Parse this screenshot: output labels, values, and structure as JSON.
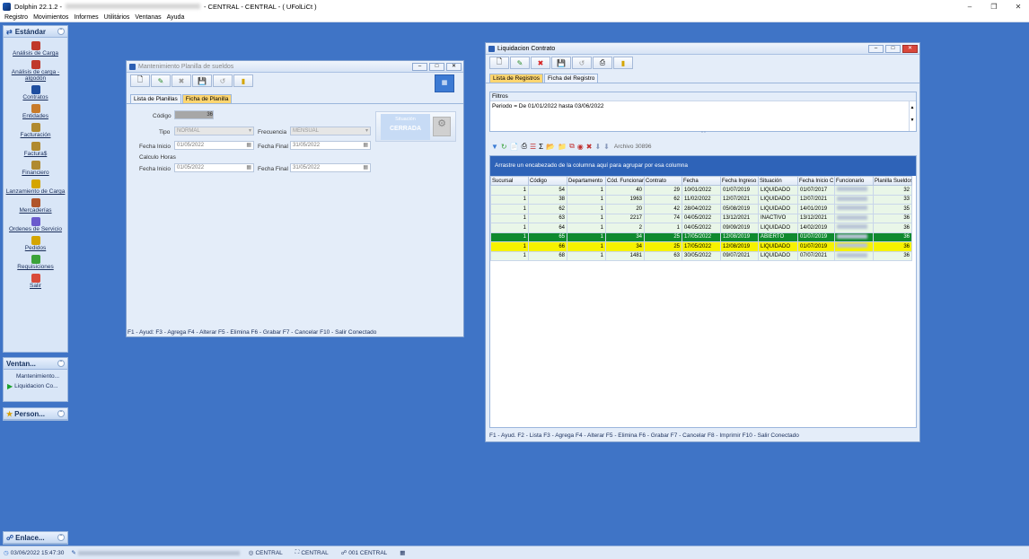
{
  "app": {
    "title_prefix": "Dolphin 22.1.2 - ",
    "title_suffix": " - CENTRAL - CENTRAL - ( UFolLiCt )"
  },
  "menu": [
    "Registro",
    "Movimientos",
    "Informes",
    "Utilitários",
    "Ventanas",
    "Ayuda"
  ],
  "sidebar": {
    "estandar": {
      "title": "Estándar",
      "items": [
        {
          "label": "Análisis de Carga",
          "icon": "truck-person-icon"
        },
        {
          "label": "Análisis de carga - algodón",
          "icon": "truck-person-icon"
        },
        {
          "label": "Contratos",
          "icon": "contract-icon"
        },
        {
          "label": "Entidades",
          "icon": "people-icon"
        },
        {
          "label": "Facturación",
          "icon": "money-bag-icon"
        },
        {
          "label": "Factura$",
          "icon": "money-bag-icon"
        },
        {
          "label": "Financiero",
          "icon": "money-bag-icon"
        },
        {
          "label": "Lanzamiento de Carga",
          "icon": "forklift-icon"
        },
        {
          "label": "Mercaderías",
          "icon": "box-icon"
        },
        {
          "label": "Ordenes de Servicio",
          "icon": "clipboard-icon"
        },
        {
          "label": "Pedidos",
          "icon": "coins-icon"
        },
        {
          "label": "Requisiciones",
          "icon": "checkmark-icon"
        },
        {
          "label": "Salir",
          "icon": "exit-icon"
        }
      ]
    },
    "ventanas": {
      "title": "Ventan...",
      "items": [
        "Mantenimiento...",
        "Liquidacion Co..."
      ]
    },
    "personal": {
      "title": "Person..."
    },
    "enlace": {
      "title": "Enlace..."
    }
  },
  "planilla": {
    "title": "Mantenimiento Planilla de sueldos",
    "tabs": [
      "Lista de Planillas",
      "Ficha de Planilla"
    ],
    "codigo_label": "Código",
    "codigo": "36",
    "tipo_label": "Tipo",
    "tipo": "NORMAL",
    "frecuencia_label": "Frecuencia",
    "frecuencia": "MENSUAL",
    "fecha_inicio_label": "Fecha Inicio",
    "fecha_inicio": "01/05/2022",
    "fecha_final_label": "Fecha Final",
    "fecha_final": "31/05/2022",
    "calculo_horas_label": "Calculo Horas",
    "horas_inicio": "01/05/2022",
    "horas_final": "31/05/2022",
    "situacion_label": "Situación",
    "situacion": "CERRADA",
    "fkeys": "F1 - Ayud: F3 - Agrega F4 - Alterar  F5 - Elimina F6 - Grabar  F7 - Cancelar  F10 - Salir Conectado"
  },
  "liquidacion": {
    "title": "Liquidacion Contrato",
    "tabs": [
      "Lista de Registros",
      "Ficha del Registro"
    ],
    "filtros_label": "Filtros",
    "filtros_text": "Periodo = De 01/01/2022 hasta 03/06/2022",
    "archivo": "Archivo 30896",
    "group_hint": "Arrastre un encabezado de la columna aquí para agrupar por esa columna",
    "columns": [
      "Sucursal",
      "Código",
      "Departamento",
      "Cód. Funcionario",
      "Contrato",
      "Fecha",
      "Fecha Ingreso",
      "Situación",
      "Fecha Inicio C",
      "Funcionario",
      "Planilla Sueldos"
    ],
    "rows": [
      {
        "sucursal": "1",
        "codigo": "54",
        "depto": "1",
        "cod_func": "40",
        "contrato": "29",
        "fecha": "10/01/2022",
        "ingreso": "01/07/2019",
        "situacion": "LIQUIDADO",
        "inicio": "01/07/2017",
        "planilla": "32",
        "style": ""
      },
      {
        "sucursal": "1",
        "codigo": "38",
        "depto": "1",
        "cod_func": "1963",
        "contrato": "62",
        "fecha": "11/02/2022",
        "ingreso": "12/07/2021",
        "situacion": "LIQUIDADO",
        "inicio": "12/07/2021",
        "planilla": "33",
        "style": ""
      },
      {
        "sucursal": "1",
        "codigo": "62",
        "depto": "1",
        "cod_func": "20",
        "contrato": "42",
        "fecha": "28/04/2022",
        "ingreso": "05/08/2019",
        "situacion": "LIQUIDADO",
        "inicio": "14/01/2019",
        "planilla": "35",
        "style": ""
      },
      {
        "sucursal": "1",
        "codigo": "63",
        "depto": "1",
        "cod_func": "2217",
        "contrato": "74",
        "fecha": "04/05/2022",
        "ingreso": "13/12/2021",
        "situacion": "INACTIVO",
        "inicio": "13/12/2021",
        "planilla": "36",
        "style": ""
      },
      {
        "sucursal": "1",
        "codigo": "64",
        "depto": "1",
        "cod_func": "2",
        "contrato": "1",
        "fecha": "04/05/2022",
        "ingreso": "09/09/2019",
        "situacion": "LIQUIDADO",
        "inicio": "14/02/2019",
        "planilla": "36",
        "style": ""
      },
      {
        "sucursal": "1",
        "codigo": "65",
        "depto": "1",
        "cod_func": "34",
        "contrato": "25",
        "fecha": "17/05/2022",
        "ingreso": "12/08/2019",
        "situacion": "ABIERTO",
        "inicio": "01/07/2019",
        "planilla": "36",
        "style": "sel"
      },
      {
        "sucursal": "1",
        "codigo": "66",
        "depto": "1",
        "cod_func": "34",
        "contrato": "25",
        "fecha": "17/05/2022",
        "ingreso": "12/08/2019",
        "situacion": "LIQUIDADO",
        "inicio": "01/07/2019",
        "planilla": "36",
        "style": "yel"
      },
      {
        "sucursal": "1",
        "codigo": "68",
        "depto": "1",
        "cod_func": "1481",
        "contrato": "63",
        "fecha": "30/05/2022",
        "ingreso": "09/07/2021",
        "situacion": "LIQUIDADO",
        "inicio": "07/07/2021",
        "planilla": "36",
        "style": ""
      }
    ],
    "fkeys": "F1 - Ayud. F2 - Lista  F3 - Agrega F4 - Alterar  F5 - Elimina F6 - Grabar  F7 - Cancelar  F8 - Imprimir F10 - Salir Conectado"
  },
  "status": {
    "datetime": "03/06/2022 15:47:30",
    "central1": "CENTRAL",
    "central2": "CENTRAL",
    "central3": "001 CENTRAL"
  },
  "colors": {
    "desktop": "#3f74c6",
    "selected_row": "#0f8a2e",
    "highlight_row": "#f6f200",
    "active_tab": "#ffd670"
  }
}
